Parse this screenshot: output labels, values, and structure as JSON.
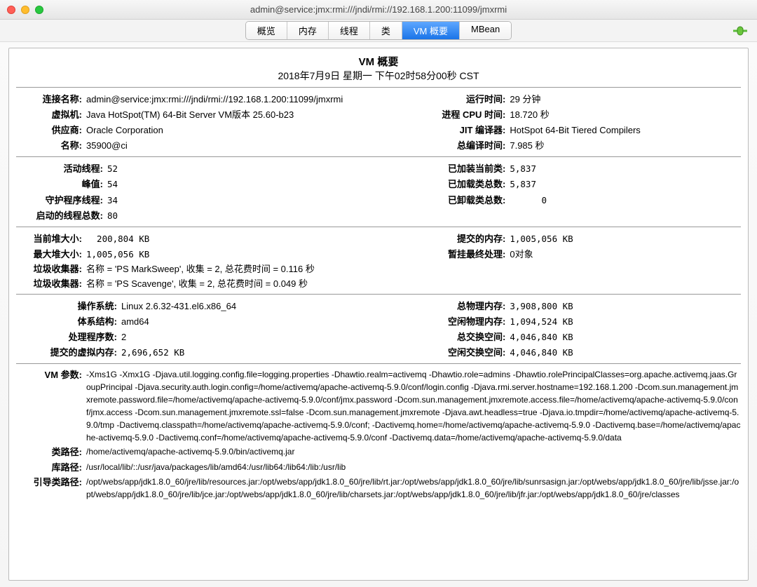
{
  "window": {
    "title": "admin@service:jmx:rmi:///jndi/rmi://192.168.1.200:11099/jmxrmi"
  },
  "tabs": {
    "overview": "概览",
    "memory": "内存",
    "threads": "线程",
    "classes": "类",
    "vmsummary": "VM 概要",
    "mbean": "MBean"
  },
  "header": {
    "title": "VM 概要",
    "datetime": "2018年7月9日 星期一 下午02时58分00秒 CST"
  },
  "sec1": {
    "conn_name_label": "连接名称:",
    "conn_name": "admin@service:jmx:rmi:///jndi/rmi://192.168.1.200:11099/jmxrmi",
    "vm_label": "虚拟机:",
    "vm": "Java HotSpot(TM) 64-Bit Server VM版本 25.60-b23",
    "vendor_label": "供应商:",
    "vendor": "Oracle Corporation",
    "name_label": "名称:",
    "name": "35900@ci",
    "uptime_label": "运行时间:",
    "uptime": "29 分钟",
    "cpu_label": "进程 CPU 时间:",
    "cpu": "18.720 秒",
    "jit_label": "JIT 编译器:",
    "jit": "HotSpot 64-Bit Tiered Compilers",
    "compile_label": "总编译时间:",
    "compile": "7.985 秒"
  },
  "sec2": {
    "live_label": "活动线程:",
    "live": "52",
    "peak_label": "峰值:",
    "peak": "54",
    "daemon_label": "守护程序线程:",
    "daemon": "34",
    "started_label": "启动的线程总数:",
    "started": "80",
    "loaded_label": "已加装当前类:",
    "loaded": "5,837",
    "total_loaded_label": "已加载类总数:",
    "total_loaded": "5,837",
    "unloaded_label": "已卸载类总数:",
    "unloaded": "      0"
  },
  "sec3": {
    "heap_label": "当前堆大小:",
    "heap": "  200,804 KB",
    "maxheap_label": "最大堆大小:",
    "maxheap": "1,005,056 KB",
    "committed_label": "提交的内存:",
    "committed": "1,005,056 KB",
    "pending_label": "暂挂最终处理:",
    "pending": "0对象",
    "gc1_label": "垃圾收集器:",
    "gc1": "名称 = 'PS MarkSweep', 收集 = 2, 总花费时间 = 0.116 秒",
    "gc2_label": "垃圾收集器:",
    "gc2": "名称 = 'PS Scavenge', 收集 = 2, 总花费时间 = 0.049 秒"
  },
  "sec4": {
    "os_label": "操作系统:",
    "os": "Linux 2.6.32-431.el6.x86_64",
    "arch_label": "体系结构:",
    "arch": "amd64",
    "proc_label": "处理程序数:",
    "proc": "2",
    "vmem_label": "提交的虚拟内存:",
    "vmem": "2,696,652 KB",
    "phymem_label": "总物理内存:",
    "phymem": "3,908,800 KB",
    "freephy_label": "空闲物理内存:",
    "freephy": "1,094,524 KB",
    "swap_label": "总交换空间:",
    "swap": "4,046,840 KB",
    "freeswap_label": "空闲交换空间:",
    "freeswap": "4,046,840 KB"
  },
  "sec5": {
    "vmargs_label": "VM 参数:",
    "vmargs": "-Xms1G -Xmx1G -Djava.util.logging.config.file=logging.properties -Dhawtio.realm=activemq -Dhawtio.role=admins -Dhawtio.rolePrincipalClasses=org.apache.activemq.jaas.GroupPrincipal -Djava.security.auth.login.config=/home/activemq/apache-activemq-5.9.0/conf/login.config -Djava.rmi.server.hostname=192.168.1.200 -Dcom.sun.management.jmxremote.password.file=/home/activemq/apache-activemq-5.9.0/conf/jmx.password -Dcom.sun.management.jmxremote.access.file=/home/activemq/apache-activemq-5.9.0/conf/jmx.access -Dcom.sun.management.jmxremote.ssl=false -Dcom.sun.management.jmxremote -Djava.awt.headless=true -Djava.io.tmpdir=/home/activemq/apache-activemq-5.9.0/tmp -Dactivemq.classpath=/home/activemq/apache-activemq-5.9.0/conf; -Dactivemq.home=/home/activemq/apache-activemq-5.9.0 -Dactivemq.base=/home/activemq/apache-activemq-5.9.0 -Dactivemq.conf=/home/activemq/apache-activemq-5.9.0/conf -Dactivemq.data=/home/activemq/apache-activemq-5.9.0/data",
    "classpath_label": "类路径:",
    "classpath": "/home/activemq/apache-activemq-5.9.0/bin/activemq.jar",
    "libpath_label": "库路径:",
    "libpath": "/usr/local/lib/::/usr/java/packages/lib/amd64:/usr/lib64:/lib64:/lib:/usr/lib",
    "bootcp_label": "引导类路径:",
    "bootcp": "/opt/webs/app/jdk1.8.0_60/jre/lib/resources.jar:/opt/webs/app/jdk1.8.0_60/jre/lib/rt.jar:/opt/webs/app/jdk1.8.0_60/jre/lib/sunrsasign.jar:/opt/webs/app/jdk1.8.0_60/jre/lib/jsse.jar:/opt/webs/app/jdk1.8.0_60/jre/lib/jce.jar:/opt/webs/app/jdk1.8.0_60/jre/lib/charsets.jar:/opt/webs/app/jdk1.8.0_60/jre/lib/jfr.jar:/opt/webs/app/jdk1.8.0_60/jre/classes"
  }
}
